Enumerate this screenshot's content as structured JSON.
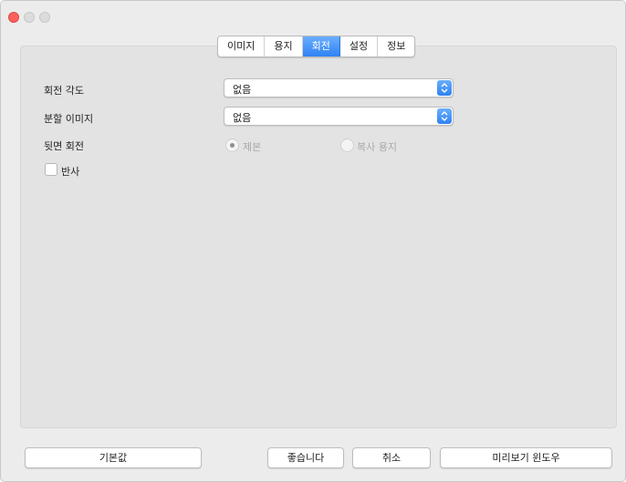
{
  "tabs": [
    {
      "label": "이미지",
      "active": false
    },
    {
      "label": "용지",
      "active": false
    },
    {
      "label": "회전",
      "active": true
    },
    {
      "label": "설정",
      "active": false
    },
    {
      "label": "정보",
      "active": false
    }
  ],
  "rotation_angle": {
    "label": "회전 각도",
    "value": "없음"
  },
  "split_image": {
    "label": "분할 이미지",
    "value": "없음"
  },
  "back_rotation": {
    "label": "뒷면 회전",
    "options": [
      {
        "label": "제본",
        "selected": true
      },
      {
        "label": "복사 용지",
        "selected": false
      }
    ]
  },
  "mirror": {
    "label": "반사",
    "checked": false
  },
  "buttons": {
    "defaults": "기본값",
    "ok": "좋습니다",
    "cancel": "취소",
    "preview": "미리보기 윈도우"
  },
  "colors": {
    "accent": "#3f8ef7",
    "close": "#fc605c"
  }
}
